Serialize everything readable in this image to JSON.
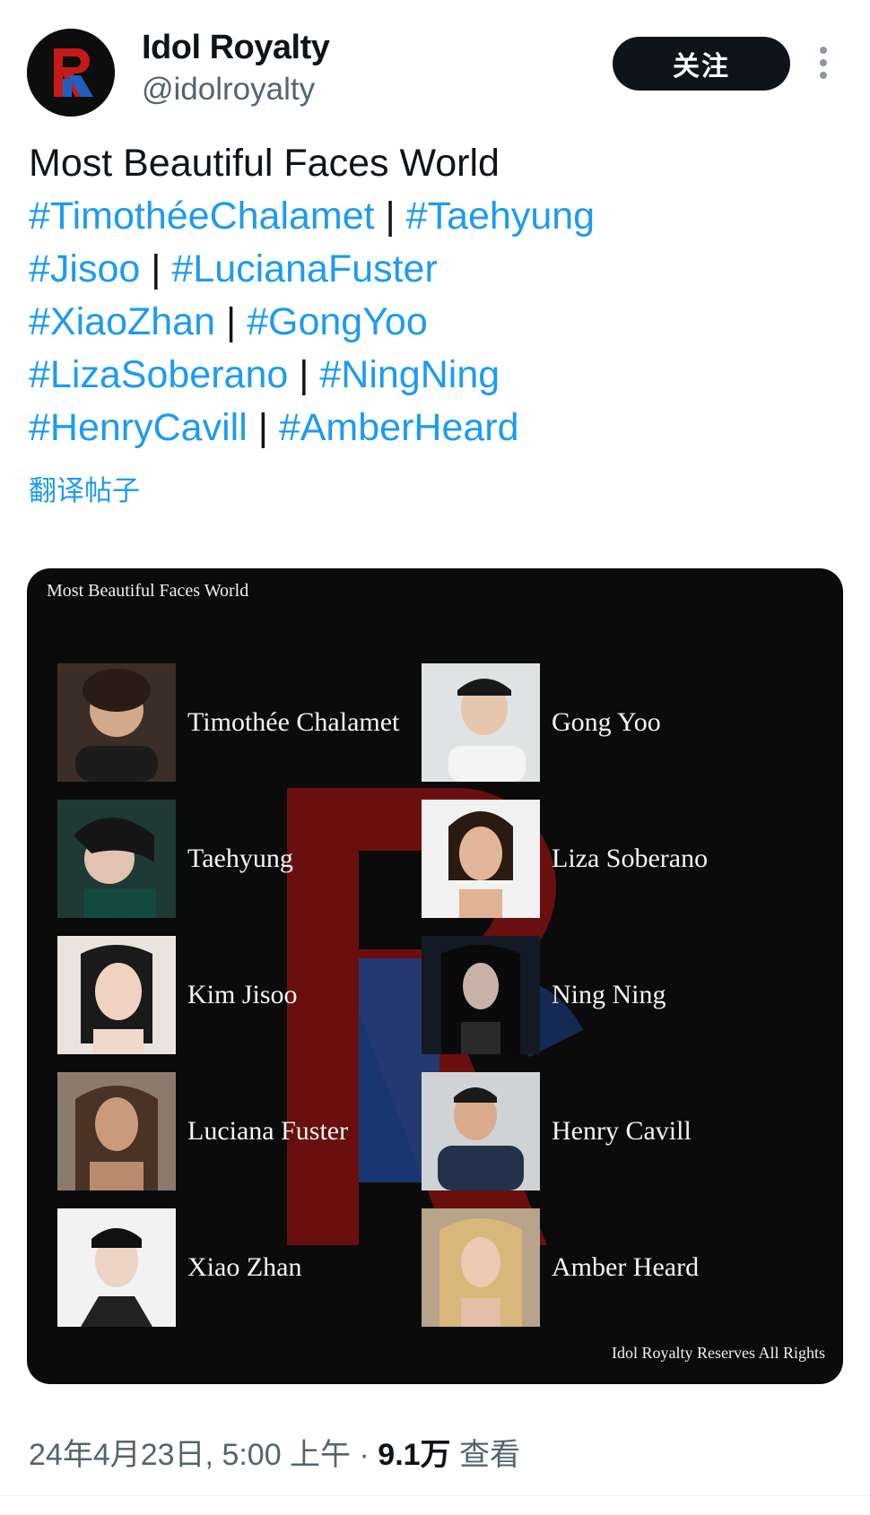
{
  "author": {
    "display_name": "Idol Royalty",
    "handle": "@idolroyalty",
    "avatar_icon": "idol-royalty-logo-icon",
    "follow_label": "关注",
    "more_icon": "more-vertical-icon"
  },
  "post": {
    "title_line": "Most Beautiful Faces World",
    "hashtag_lines": [
      [
        "#TimothéeChalamet",
        "#Taehyung"
      ],
      [
        "#Jisoo",
        "#LucianaFuster"
      ],
      [
        "#XiaoZhan",
        "#GongYoo"
      ],
      [
        "#LizaSoberano",
        "#NingNing"
      ],
      [
        "#HenryCavill",
        "#AmberHeard"
      ]
    ],
    "separator": "|",
    "translate_label": "翻译帖子"
  },
  "media": {
    "title": "Most Beautiful Faces World",
    "footer": "Idol Royalty Reserves All Rights",
    "left_column": [
      "Timothée Chalamet",
      "Taehyung",
      "Kim Jisoo",
      "Luciana Fuster",
      "Xiao Zhan"
    ],
    "right_column": [
      "Gong Yoo",
      "Liza Soberano",
      "Ning Ning",
      "Henry Cavill",
      "Amber Heard"
    ]
  },
  "meta": {
    "timestamp": "24年4月23日, 5:00 上午",
    "dot": "·",
    "views_count": "9.1万",
    "views_label": "查看"
  },
  "colors": {
    "accent": "#1d9bf0",
    "text": "#0f1419",
    "muted": "#536471",
    "logo_red": "#c41a1a",
    "logo_blue": "#1f5fbf"
  }
}
